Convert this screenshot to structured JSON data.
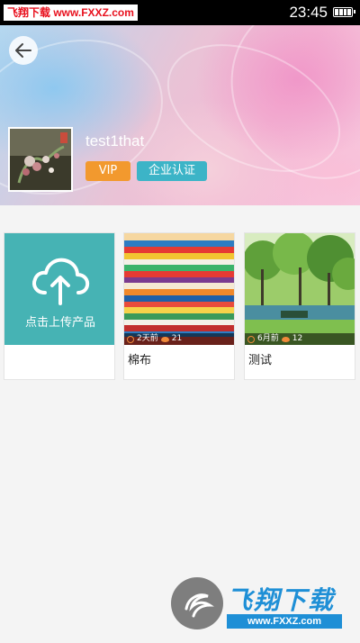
{
  "status_bar": {
    "watermark": "飞翔下载 www.FXXZ.com",
    "time": "23:45"
  },
  "profile": {
    "username": "test1that",
    "badges": [
      "VIP",
      "企业认证"
    ]
  },
  "upload_card": {
    "label": "点击上传产品"
  },
  "products": [
    {
      "title": "棉布",
      "time_ago": "2天前",
      "views": "21"
    },
    {
      "title": "测试",
      "time_ago": "6月前",
      "views": "12"
    }
  ],
  "watermark_bottom": {
    "brand": "飞翔下载",
    "url": "www.FXXZ.com"
  },
  "colors": {
    "upload_bg": "#46b3b4",
    "vip_badge": "#f2992e",
    "cert_badge": "#3cb4c7",
    "watermark_blue": "#1e8fd6"
  },
  "icons": [
    "back-arrow-icon",
    "battery-icon",
    "cloud-upload-icon",
    "clock-icon",
    "eye-icon"
  ]
}
